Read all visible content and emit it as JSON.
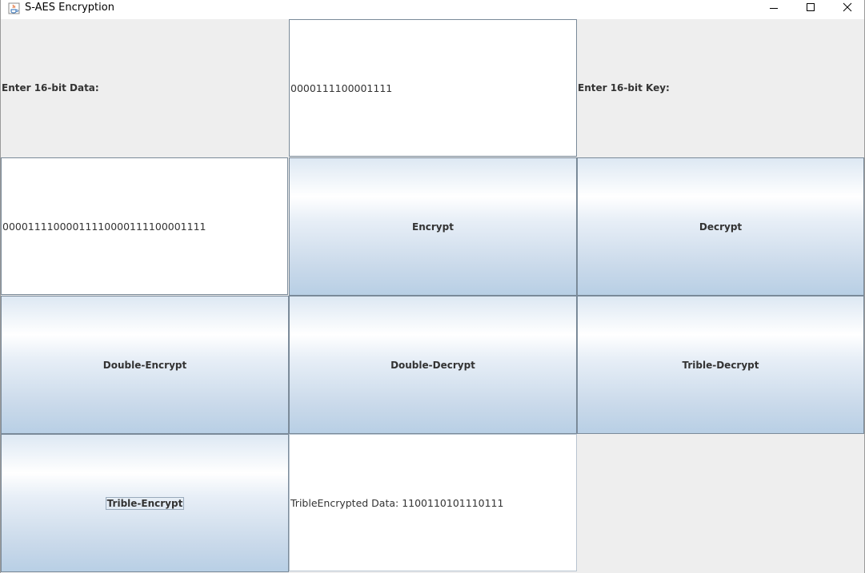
{
  "window": {
    "title": "S-AES Encryption",
    "icon": "java-cup-icon",
    "controls": [
      "minimize-icon",
      "maximize-icon",
      "close-icon"
    ]
  },
  "form": {
    "data_label": "Enter 16-bit Data:",
    "data_value": "0000111100001111",
    "key_label": "Enter 16-bit Key:",
    "key_value": "00001111000011110000111100001111"
  },
  "buttons": {
    "encrypt": "Encrypt",
    "decrypt": "Decrypt",
    "double_encrypt": "Double-Encrypt",
    "double_decrypt": "Double-Decrypt",
    "trible_decrypt": "Trible-Decrypt",
    "trible_encrypt": "Trible-Encrypt"
  },
  "result": {
    "text": "TribleEncrypted Data: 1100110101110111"
  }
}
